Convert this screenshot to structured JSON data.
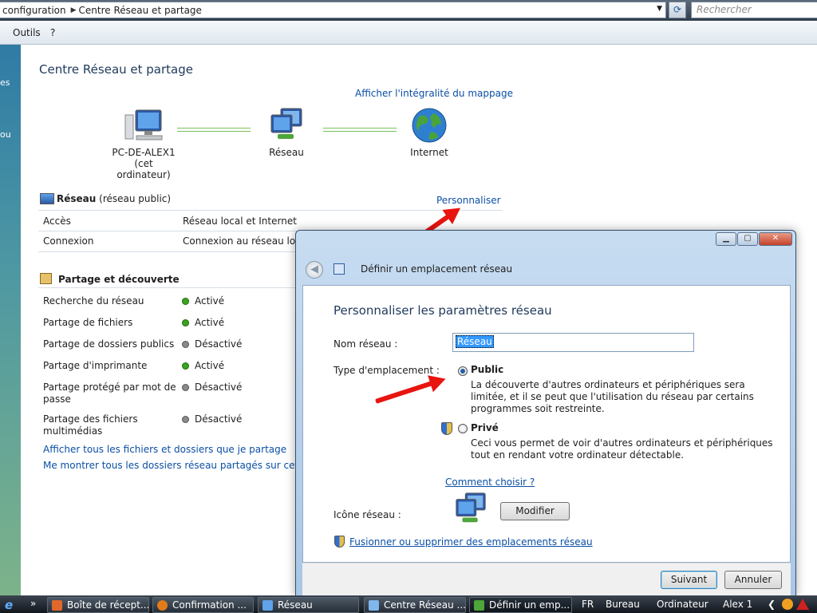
{
  "addressbar": {
    "crumbs": [
      "configuration",
      "Centre Réseau et partage"
    ],
    "search_placeholder": "Rechercher"
  },
  "menubar": {
    "items": [
      "Outils",
      "?"
    ]
  },
  "leftpane": {
    "fragments": [
      "es",
      "ou"
    ]
  },
  "main": {
    "title": "Centre Réseau et partage",
    "map_link": "Afficher l'intégralité du mappage",
    "nodes": {
      "pc_name": "PC-DE-ALEX1",
      "pc_sub": "(cet ordinateur)",
      "network": "Réseau",
      "internet": "Internet"
    },
    "network_section": {
      "name": "Réseau",
      "type": "(réseau public)",
      "customize_link": "Personnaliser",
      "rows": [
        {
          "key": "Accès",
          "value": "Réseau local et Internet"
        },
        {
          "key": "Connexion",
          "value": "Connexion au réseau local"
        }
      ]
    },
    "sharing_section": {
      "title": "Partage et découverte",
      "rows": [
        {
          "key": "Recherche du réseau",
          "value": "Activé",
          "on": true
        },
        {
          "key": "Partage de fichiers",
          "value": "Activé",
          "on": true
        },
        {
          "key": "Partage de dossiers publics",
          "value": "Désactivé",
          "on": false
        },
        {
          "key": "Partage d'imprimante",
          "value": "Activé",
          "on": true
        },
        {
          "key": "Partage protégé par mot de passe",
          "value": "Désactivé",
          "on": false
        },
        {
          "key": "Partage des fichiers multimédias",
          "value": "Désactivé",
          "on": false
        }
      ]
    },
    "links": {
      "show_files": "Afficher tous les fichiers et dossiers que je partage",
      "show_folders": "Me montrer tous les dossiers réseau partagés sur cet ordinat"
    }
  },
  "dialog": {
    "title": "Définir un emplacement réseau",
    "heading": "Personnaliser les paramètres réseau",
    "name_label": "Nom réseau :",
    "name_value": "Réseau",
    "location_label": "Type d'emplacement :",
    "options": {
      "public": {
        "label": "Public",
        "desc": "La découverte d'autres ordinateurs et périphériques sera limitée, et il se peut que l'utilisation du réseau par certains programmes soit restreinte."
      },
      "private": {
        "label": "Privé",
        "desc": "Ceci vous permet de voir d'autres ordinateurs et périphériques tout en rendant votre ordinateur détectable."
      }
    },
    "how_choose": "Comment choisir ?",
    "icon_label": "Icône réseau :",
    "modify_btn": "Modifier",
    "merge_link": "Fusionner ou supprimer des emplacements réseau",
    "next_btn": "Suivant",
    "cancel_btn": "Annuler"
  },
  "taskbar": {
    "items": [
      "Boîte de récept...",
      "Confirmation ...",
      "Réseau",
      "Centre Réseau ...",
      "Définir un emp..."
    ],
    "lang": "FR",
    "bureau": "Bureau",
    "ordinateur": "Ordinateur",
    "user": "Alex 1"
  },
  "colors": {
    "link": "#0b4fa6",
    "title": "#1e395b",
    "annotation_arrow": "#e8140f",
    "status_on": "#3aa41e",
    "status_off": "#8a8a8a"
  }
}
